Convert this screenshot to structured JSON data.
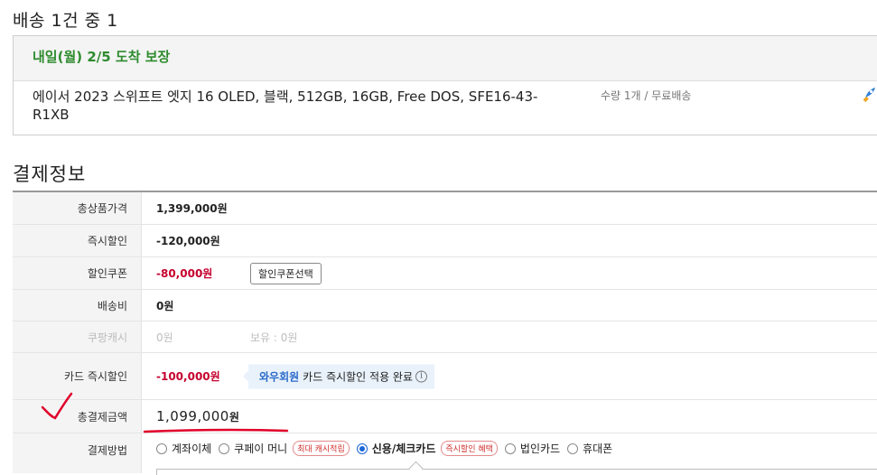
{
  "delivery": {
    "heading": "배송 1건 중 1",
    "date": "내일(월) 2/5 도착 보장",
    "product_name": "에이서 2023 스위프트 엣지 16 OLED, 블랙, 512GB, 16GB, Free DOS, SFE16-43-R1XB",
    "quantity_shipping": "수량 1개 / 무료배송",
    "rocket_icon": "rocket-icon"
  },
  "payment": {
    "heading": "결제정보",
    "rows": {
      "total_price": {
        "label": "총상품가격",
        "value": "1,399,000원"
      },
      "instant_discount": {
        "label": "즉시할인",
        "value": "-120,000원"
      },
      "coupon": {
        "label": "할인쿠폰",
        "value": "-80,000원",
        "button": "할인쿠폰선택"
      },
      "shipping": {
        "label": "배송비",
        "value": "0원"
      },
      "coupang_cash": {
        "label": "쿠팡캐시",
        "value": "0원",
        "hold": "보유 : 0원"
      },
      "card_discount": {
        "label": "카드 즉시할인",
        "value": "-100,000원",
        "note_wow": "와우회원",
        "note_text": "카드 즉시할인 적용 완료",
        "info_icon": "i"
      },
      "total_payment": {
        "label": "총결제금액",
        "amount": "1,099,000",
        "unit": "원"
      },
      "method": {
        "label": "결제방법",
        "options": [
          {
            "label": "계좌이체",
            "selected": false,
            "tag": ""
          },
          {
            "label": "쿠페이 머니",
            "selected": false,
            "tag": "최대 캐시적립"
          },
          {
            "label": "신용/체크카드",
            "selected": true,
            "tag": "즉시할인 혜택"
          },
          {
            "label": "법인카드",
            "selected": false,
            "tag": ""
          },
          {
            "label": "휴대폰",
            "selected": false,
            "tag": ""
          }
        ]
      }
    }
  },
  "colors": {
    "delivery_green": "#2e8b2e",
    "discount_red": "#c5002d",
    "wow_blue": "#2a6ac8",
    "annotation_red": "#e0002a"
  }
}
